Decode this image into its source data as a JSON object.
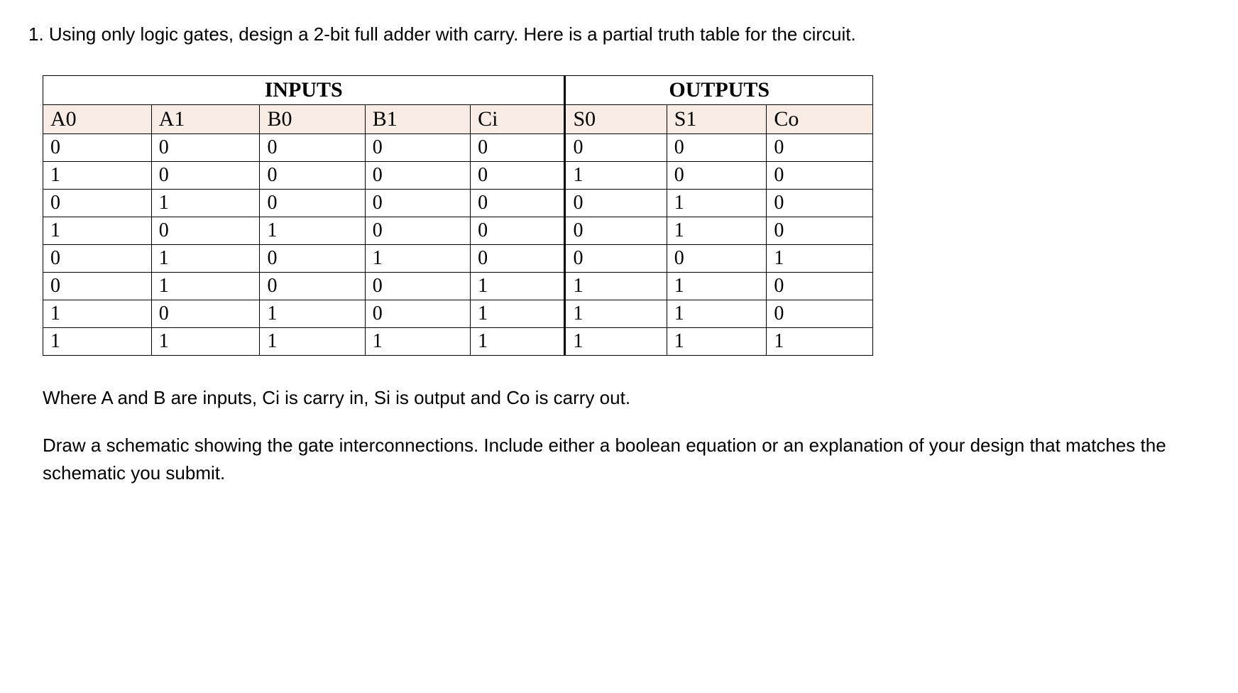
{
  "question": "1. Using only logic gates, design a 2-bit full adder with carry. Here is a partial truth table for the circuit.",
  "table": {
    "group_headers": [
      "INPUTS",
      "OUTPUTS"
    ],
    "col_headers": [
      "A0",
      "A1",
      "B0",
      "B1",
      "Ci",
      "S0",
      "S1",
      "Co"
    ],
    "rows": [
      [
        "0",
        "0",
        "0",
        "0",
        "0",
        "0",
        "0",
        "0"
      ],
      [
        "1",
        "0",
        "0",
        "0",
        "0",
        "1",
        "0",
        "0"
      ],
      [
        "0",
        "1",
        "0",
        "0",
        "0",
        "0",
        "1",
        "0"
      ],
      [
        "1",
        "0",
        "1",
        "0",
        "0",
        "0",
        "1",
        "0"
      ],
      [
        "0",
        "1",
        "0",
        "1",
        "0",
        "0",
        "0",
        "1"
      ],
      [
        "0",
        "1",
        "0",
        "0",
        "1",
        "1",
        "1",
        "0"
      ],
      [
        "1",
        "0",
        "1",
        "0",
        "1",
        "1",
        "1",
        "0"
      ],
      [
        "1",
        "1",
        "1",
        "1",
        "1",
        "1",
        "1",
        "1"
      ]
    ]
  },
  "footer": {
    "line1": "Where A and B are inputs, Ci is carry in, Si is output and Co is carry out.",
    "line2": "Draw a schematic showing the gate interconnections. Include either a boolean equation or an explanation of your design that matches the schematic you submit."
  }
}
